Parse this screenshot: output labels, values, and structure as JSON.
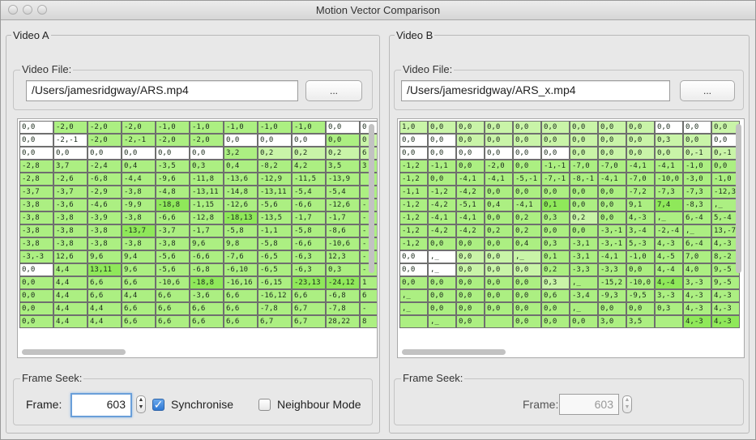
{
  "window": {
    "title": "Motion Vector Comparison"
  },
  "colors": {
    "white": "#ffffff",
    "light": "#c9f4a8",
    "mid": "#acef82",
    "bright": "#8fe85a"
  },
  "videoA": {
    "title": "Video A",
    "file_group": "Video File:",
    "path": "/Users/jamesridgway/ARS.mp4",
    "browse": "...",
    "frame_group": "Frame Seek:",
    "frame_label": "Frame:",
    "frame_value": "603",
    "stepper_up": "▲",
    "stepper_down": "▼",
    "sync_label": "Synchronise",
    "sync_checked": true,
    "neighbour_label": "Neighbour Mode",
    "neighbour_checked": false,
    "rows": [
      [
        "0,0",
        "-2,0",
        "-2,0",
        "-2,0",
        "-1,0",
        "-1,0",
        "-1,0",
        "-1,0",
        "-1,0",
        "0,0",
        "0"
      ],
      [
        "0,0",
        "-2,-1",
        "-2,0",
        "-2,-1",
        "-2,0",
        "-2,0",
        "0,0",
        "0,0",
        "0,0",
        "0,0",
        "0"
      ],
      [
        "0,0",
        "0,0",
        "0,0",
        "0,0",
        "0,0",
        "0,0",
        "3,2",
        "0,2",
        "0,2",
        "0,2",
        "6"
      ],
      [
        "-2,8",
        "3,7",
        "-2,4",
        "0,4",
        "-3,5",
        "0,3",
        "0,4",
        "-8,2",
        "4,2",
        "3,5",
        "3"
      ],
      [
        "-2,8",
        "-2,6",
        "-6,8",
        "-4,4",
        "-9,6",
        "-11,8",
        "-13,6",
        "-12,9",
        "-11,5",
        "-13,9",
        ""
      ],
      [
        "-3,7",
        "-3,7",
        "-2,9",
        "-3,8",
        "-4,8",
        "-13,11",
        "-14,8",
        "-13,11",
        "-5,4",
        "-5,4",
        ""
      ],
      [
        "-3,8",
        "-3,6",
        "-4,6",
        "-9,9",
        "-18,8",
        "-1,15",
        "-12,6",
        "-5,6",
        "-6,6",
        "-12,6",
        "-"
      ],
      [
        "-3,8",
        "-3,8",
        "-3,9",
        "-3,8",
        "-6,6",
        "-12,8",
        "-18,13",
        "-13,5",
        "-1,7",
        "-1,7",
        "-"
      ],
      [
        "-3,8",
        "-3,8",
        "-3,8",
        "-13,7",
        "-3,7",
        "-1,7",
        "-5,8",
        "-1,1",
        "-5,8",
        "-8,6",
        "-"
      ],
      [
        "-3,8",
        "-3,8",
        "-3,8",
        "-3,8",
        "-3,8",
        "9,6",
        "9,8",
        "-5,8",
        "-6,6",
        "-10,6",
        "-"
      ],
      [
        "-3,-3",
        "12,6",
        "9,6",
        "9,4",
        "-5,6",
        "-6,6",
        "-7,6",
        "-6,5",
        "-6,3",
        "12,3",
        "-"
      ],
      [
        "0,0",
        "4,4",
        "13,11",
        "9,6",
        "-5,6",
        "-6,8",
        "-6,10",
        "-6,5",
        "-6,3",
        "0,3",
        "-"
      ],
      [
        "0,0",
        "4,4",
        "6,6",
        "6,6",
        "-10,6",
        "-18,8",
        "-16,16",
        "-6,15",
        "-23,13",
        "-24,12",
        "1"
      ],
      [
        "0,0",
        "4,4",
        "6,6",
        "4,4",
        "6,6",
        "-3,6",
        "6,6",
        "-16,12",
        "6,6",
        "-6,8",
        "6"
      ],
      [
        "0,0",
        "4,4",
        "4,4",
        "6,6",
        "6,6",
        "6,6",
        "6,6",
        "-7,8",
        "6,7",
        "-7,8",
        "-"
      ],
      [
        "0,0",
        "4,4",
        "4,4",
        "6,6",
        "6,6",
        "6,6",
        "6,6",
        "6,7",
        "6,7",
        "28,22",
        "8"
      ]
    ],
    "shades": [
      "w m m m m m m m m w w",
      "w w m m m m w w w m l",
      "w w w w w w m l l l l",
      "m m m m m m m m m m m",
      "m m m m m m m m m m m",
      "m m m m m m m m m m m",
      "m m m m b m m m m m m",
      "m m m m m m b m m m m",
      "m m m b m m m m m m m",
      "m m m m m m m m m m m",
      "m m m m m m m m m m m",
      "w m b m m m m m m m m",
      "m m m m m b m m b b m",
      "m m m m m m m m m m m",
      "m m m m m m m m m m m",
      "m m m m m m m m m m m"
    ]
  },
  "videoB": {
    "title": "Video B",
    "file_group": "Video File:",
    "path": "/Users/jamesridgway/ARS_x.mp4",
    "browse": "...",
    "frame_group": "Frame Seek:",
    "frame_label": "Frame:",
    "frame_value": "603",
    "stepper_up": "▲",
    "stepper_down": "▼",
    "rows": [
      [
        "1,0",
        "0,0",
        "0,0",
        "0,0",
        "0,0",
        "0,0",
        "0,0",
        "0,0",
        "0,0",
        "0,0",
        "0,0",
        "0,0"
      ],
      [
        "0,0",
        "0,0",
        "0,0",
        "0,0",
        "0,0",
        "0,0",
        "0,0",
        "0,0",
        "0,0",
        "0,3",
        "0,0",
        "0,0"
      ],
      [
        "0,0",
        "0,0",
        "0,0",
        "0,0",
        "0,0",
        "0,0",
        "0,0",
        "0,0",
        "0,0",
        "0,0",
        "0,-1",
        "0,-1"
      ],
      [
        "-1,2",
        "-1,1",
        "0,0",
        "-2,0",
        "0,0",
        "-1,-1",
        "-7,0",
        "-7,0",
        "-4,1",
        "-4,1",
        "-1,0",
        "0,0"
      ],
      [
        "-1,2",
        "0,0",
        "-4,1",
        "-4,1",
        "-5,-1",
        "-7,-1",
        "-8,-1",
        "-4,1",
        "-7,0",
        "-10,0",
        "-3,0",
        "-1,0"
      ],
      [
        "-1,1",
        "-1,2",
        "-4,2",
        "0,0",
        "0,0",
        "0,0",
        "0,0",
        "0,0",
        "-7,2",
        "-7,3",
        "-7,3",
        "-12,3"
      ],
      [
        "-1,2",
        "-4,2",
        "-5,1",
        "0,4",
        "-4,1",
        "0,1",
        "0,0",
        "0,0",
        "9,1",
        "7,4",
        "-8,3",
        ",_"
      ],
      [
        "-1,2",
        "-4,1",
        "-4,1",
        "0,0",
        "0,2",
        "0,3",
        "0,2",
        "0,0",
        "4,-3",
        ",_",
        "6,-4",
        "5,-4"
      ],
      [
        "-1,2",
        "-4,2",
        "-4,2",
        "0,2",
        "0,2",
        "0,0",
        "0,0",
        "-3,-1",
        "3,-4",
        "-2,-4",
        ",_",
        "13,-7"
      ],
      [
        "-1,2",
        "0,0",
        "0,0",
        "0,0",
        "0,4",
        "0,3",
        "-3,1",
        "-3,-1",
        "5,-3",
        "4,-3",
        "6,-4",
        "4,-3"
      ],
      [
        "0,0",
        ",_",
        "0,0",
        "0,0",
        ",_",
        "0,1",
        "-3,1",
        "-4,1",
        "-1,0",
        "4,-5",
        "7,0",
        "8,-2"
      ],
      [
        "0,0",
        ",_",
        "0,0",
        "0,0",
        "0,0",
        "0,2",
        "-3,3",
        "-3,3",
        "0,0",
        "4,-4",
        "4,0",
        "9,-5"
      ],
      [
        "0,0",
        "0,0",
        "0,0",
        "0,0",
        "0,0",
        "0,3",
        ",_",
        "-15,2",
        "-10,0",
        "4,-4",
        "3,-3",
        "9,-5"
      ],
      [
        ",_",
        "0,0",
        "0,0",
        "0,0",
        "0,0",
        "0,6",
        "-3,4",
        "-9,3",
        "-9,5",
        "3,-3",
        "4,-3",
        "4,-3"
      ],
      [
        ",_",
        "0,0",
        "0,0",
        "0,0",
        "0,0",
        "0,0",
        ",_",
        "0,0",
        "0,0",
        "0,3",
        "4,-3",
        "4,-3"
      ],
      [
        "",
        ",_",
        "0,0",
        "",
        "0,0",
        "0,0",
        "0,0",
        "3,0",
        "3,5",
        "",
        "4,-3",
        "4,-3"
      ]
    ],
    "shades": [
      "l l l l l l l l l w w l",
      "w w l l l l l l l l l w",
      "w w w w w w l l l l l l",
      "m m m m m m m m m m m m",
      "m m m m m m m m m m m m",
      "m m m m m m m m m m m m",
      "m m m m m b m m m b m m",
      "m m m m m m l m m m m m",
      "m m m m m m m m m m m m",
      "m m m m m m m m m m m m",
      "w w l l l m m m m m m m",
      "w w l l l m m m m m m m",
      "m m m m m l m m m b m m",
      "m m m m m m m m m m m m",
      "m m m m m m m m m m m m",
      "m m m m m m m m m m b b"
    ]
  }
}
